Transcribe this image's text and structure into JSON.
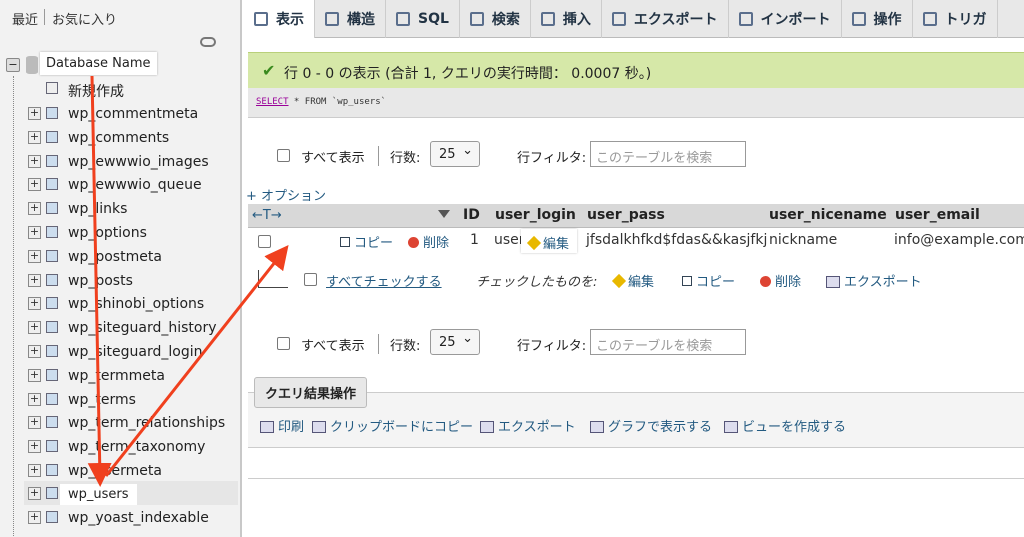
{
  "sidebar": {
    "recent": "最近",
    "favorites": "お気に入り",
    "database_name": "Database Name",
    "new": "新規作成",
    "tables": [
      "wp_commentmeta",
      "wp_comments",
      "wp_ewwwio_images",
      "wp_ewwwio_queue",
      "wp_links",
      "wp_options",
      "wp_postmeta",
      "wp_posts",
      "wp_shinobi_options",
      "wp_siteguard_history",
      "wp_siteguard_login",
      "wp_termmeta",
      "wp_terms",
      "wp_term_relationships",
      "wp_term_taxonomy",
      "wp_usermeta"
    ],
    "selected_table": "wp_users",
    "next_table": "wp_yoast_indexable"
  },
  "tabs": [
    "表示",
    "構造",
    "SQL",
    "検索",
    "挿入",
    "エクスポート",
    "インポート",
    "操作",
    "トリガ"
  ],
  "success": "行 0 - 0 の表示 (合計 1, クエリの実行時間： 0.0007 秒。)",
  "sql": {
    "kw1": "SELECT",
    "rest": " * FROM `wp_users`"
  },
  "nav": {
    "show_all": "すべて表示",
    "rows_label": "行数:",
    "rows_value": "25",
    "filter_label": "行フィルタ:",
    "filter_placeholder": "このテーブルを検索"
  },
  "options": "+ オプション",
  "table": {
    "arrows": "←T→",
    "headers": [
      "ID",
      "user_login",
      "user_pass",
      "user_nicename",
      "user_email"
    ],
    "actions": {
      "edit": "編集",
      "copy": "コピー",
      "delete": "削除"
    },
    "row": [
      "1",
      "username",
      "jfsdalkhfkd$fdas&&kasjfkj",
      "nickname",
      "info@example.com"
    ]
  },
  "bulk": {
    "check_all": "すべてチェックする",
    "with_selected": "チェックしたものを:",
    "edit": "編集",
    "copy": "コピー",
    "delete": "削除",
    "export": "エクスポート"
  },
  "query_results": {
    "title": "クエリ結果操作",
    "print": "印刷",
    "clipboard": "クリップボードにコピー",
    "export": "エクスポート",
    "chart": "グラフで表示する",
    "view": "ビューを作成する"
  },
  "colors": {
    "link": "#235a81",
    "success_bg": "#d6e8a8",
    "arrow": "#f0401e"
  }
}
